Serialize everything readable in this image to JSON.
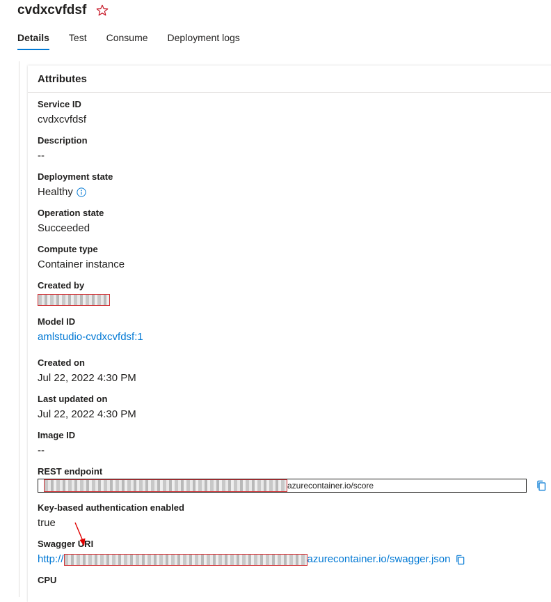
{
  "header": {
    "title": "cvdxcvfdsf",
    "star_icon": "star-outline-icon"
  },
  "tabs": [
    {
      "label": "Details",
      "active": true
    },
    {
      "label": "Test",
      "active": false
    },
    {
      "label": "Consume",
      "active": false
    },
    {
      "label": "Deployment logs",
      "active": false
    }
  ],
  "card": {
    "title": "Attributes"
  },
  "attributes": {
    "service_id": {
      "label": "Service ID",
      "value": "cvdxcvfdsf"
    },
    "description": {
      "label": "Description",
      "value": "--"
    },
    "deployment_state": {
      "label": "Deployment state",
      "value": "Healthy",
      "icon": "info-icon"
    },
    "operation_state": {
      "label": "Operation state",
      "value": "Succeeded"
    },
    "compute_type": {
      "label": "Compute type",
      "value": "Container instance"
    },
    "created_by": {
      "label": "Created by"
    },
    "model_id": {
      "label": "Model ID",
      "value": "amlstudio-cvdxcvfdsf:1"
    },
    "created_on": {
      "label": "Created on",
      "value": "Jul 22, 2022 4:30 PM"
    },
    "last_updated_on": {
      "label": "Last updated on",
      "value": "Jul 22, 2022 4:30 PM"
    },
    "image_id": {
      "label": "Image ID",
      "value": "--"
    },
    "rest_endpoint": {
      "label": "REST endpoint",
      "visible_suffix": "azurecontainer.io/score",
      "copy_icon": "copy-icon"
    },
    "key_auth": {
      "label": "Key-based authentication enabled",
      "value": "true"
    },
    "swagger_uri": {
      "label": "Swagger URI",
      "visible_prefix": "http://",
      "visible_suffix": "azurecontainer.io/swagger.json",
      "copy_icon": "copy-icon"
    },
    "cpu": {
      "label": "CPU"
    }
  },
  "colors": {
    "accent": "#0078d4",
    "redaction_border": "#d13438",
    "annotation_arrow": "#e00000"
  }
}
